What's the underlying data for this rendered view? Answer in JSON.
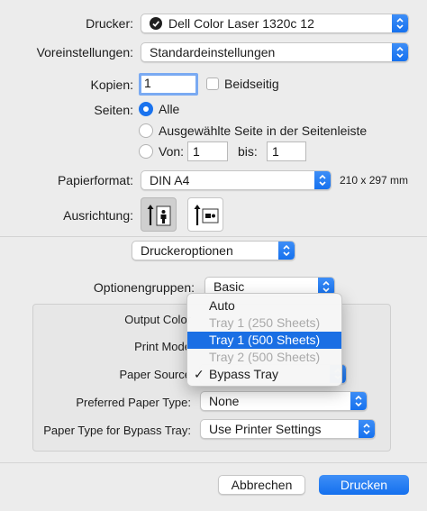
{
  "printer": {
    "label": "Drucker:",
    "value": "Dell Color Laser 1320c 12"
  },
  "presets": {
    "label": "Voreinstellungen:",
    "value": "Standardeinstellungen"
  },
  "copies": {
    "label": "Kopien:",
    "value": "1",
    "duplex_label": "Beidseitig"
  },
  "pages": {
    "label": "Seiten:",
    "all_label": "Alle",
    "selected_label": "Ausgewählte Seite in der Seitenleiste",
    "from_label": "Von:",
    "from_value": "1",
    "to_label": "bis:",
    "to_value": "1",
    "selected_option": "Alle"
  },
  "paper_size": {
    "label": "Papierformat:",
    "value": "DIN A4",
    "dimensions": "210 x 297 mm"
  },
  "orientation": {
    "label": "Ausrichtung:",
    "selected": "portrait"
  },
  "section": {
    "value": "Druckeroptionen"
  },
  "option_groups": {
    "label": "Optionengruppen:",
    "value": "Basic"
  },
  "options": {
    "output_color_label": "Output Color",
    "print_mode_label": "Print Mode",
    "paper_source_label": "Paper Source",
    "preferred_paper_type_label": "Preferred Paper Type:",
    "preferred_paper_type_value": "None",
    "bypass_paper_type_label": "Paper Type for Bypass Tray:",
    "bypass_paper_type_value": "Use Printer Settings"
  },
  "paper_source_menu": {
    "items": [
      {
        "label": "Auto",
        "state": "enabled"
      },
      {
        "label": "Tray 1 (250 Sheets)",
        "state": "disabled"
      },
      {
        "label": "Tray 1 (500 Sheets)",
        "state": "highlighted"
      },
      {
        "label": "Tray 2 (500 Sheets)",
        "state": "disabled"
      },
      {
        "label": "Bypass Tray",
        "state": "checked"
      }
    ],
    "check_mark": "✓"
  },
  "footer": {
    "cancel_label": "Abbrechen",
    "print_label": "Drucken"
  },
  "colors": {
    "accent": "#1a73ee",
    "highlight": "#1a6fe4",
    "window_bg": "#ececec"
  }
}
